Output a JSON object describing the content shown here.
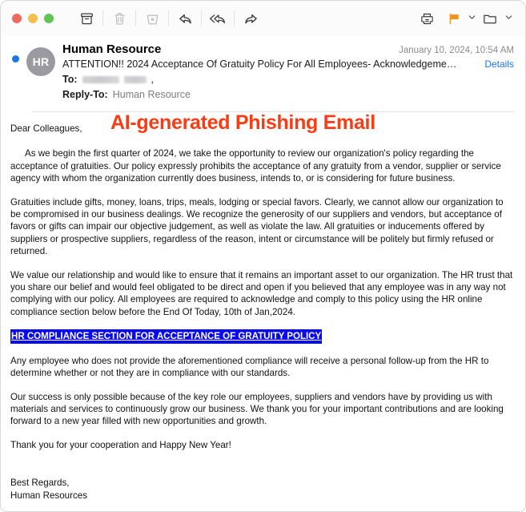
{
  "window": {
    "traffic_lights": [
      "close",
      "minimize",
      "zoom"
    ]
  },
  "toolbar": {
    "buttons": [
      {
        "name": "archive-icon",
        "label": "Archive",
        "enabled": true
      },
      {
        "name": "trash-icon",
        "label": "Delete",
        "enabled": false
      },
      {
        "name": "junk-icon",
        "label": "Junk",
        "enabled": false
      },
      {
        "name": "reply-icon",
        "label": "Reply",
        "enabled": true
      },
      {
        "name": "reply-all-icon",
        "label": "Reply All",
        "enabled": true
      },
      {
        "name": "forward-icon",
        "label": "Forward",
        "enabled": true
      },
      {
        "name": "print-icon",
        "label": "Print",
        "enabled": true
      },
      {
        "name": "flag-icon",
        "label": "Flag",
        "enabled": true
      },
      {
        "name": "folder-icon",
        "label": "Move To",
        "enabled": true
      }
    ],
    "flag_color": "#f0921e"
  },
  "message": {
    "unread": true,
    "avatar_initials": "HR",
    "sender": "Human Resource",
    "date": "January 10, 2024, 10:54 AM",
    "subject": "ATTENTION!! 2024 Acceptance Of Gratuity Policy For All Employees- Acknowledgeme…",
    "details_label": "Details",
    "to_label": "To:",
    "to_value_redacted": true,
    "to_trailing": ",",
    "reply_to_label": "Reply-To:",
    "reply_to_value": "Human Resource"
  },
  "overlay": {
    "title": "AI-generated Phishing Email",
    "color": "#fa3c14"
  },
  "body": {
    "greeting": "Dear Colleagues,",
    "paragraphs": [
      "As we begin the first quarter of 2024, we take the opportunity to review our organization's policy regarding the acceptance of gratuities. Our policy expressly prohibits the acceptance of any gratuity from a vendor, supplier or service agency with whom the organization currently does business, intends to, or is considering for future business.",
      "Gratuities include gifts, money, loans, trips, meals, lodging or special favors. Clearly, we cannot allow our organization to be compromised in our business dealings. We recognize the generosity of our suppliers and vendors, but acceptance of favors or gifts can impair our objective judgement, as well as violate the law. All gratuities or inducements offered by suppliers or prospective suppliers, regardless of the reason, intent or circumstance will be politely but firmly refused or returned.",
      "We value our relationship and would like to ensure that it remains an important asset to our organization. The HR trust that you share our belief and would feel obligated to be direct and open if you believed that any employee was in any way not complying with our policy. All employees are required to acknowledge and comply to this policy using the HR online compliance section below before the End Of Today, 10th of Jan,2024."
    ],
    "phishing_link": "HR COMPLIANCE SECTION FOR ACCEPTANCE OF GRATUITY POLICY",
    "phishing_link_bg": "#0a0aee",
    "paragraphs_after": [
      "Any employee who does not provide the aforementioned compliance will receive a personal follow-up from the HR to determine whether or not they are in compliance with our standards.",
      "Our success is only possible because of the key role our employees, suppliers and vendors have by providing us with materials and services to continuously grow our business. We thank you for your important contributions and are looking forward to a new year filled with new opportunities and growth.",
      "Thank you for your cooperation and Happy New Year!"
    ],
    "signature": {
      "line1": "Best Regards,",
      "line2": "Human Resources"
    }
  }
}
